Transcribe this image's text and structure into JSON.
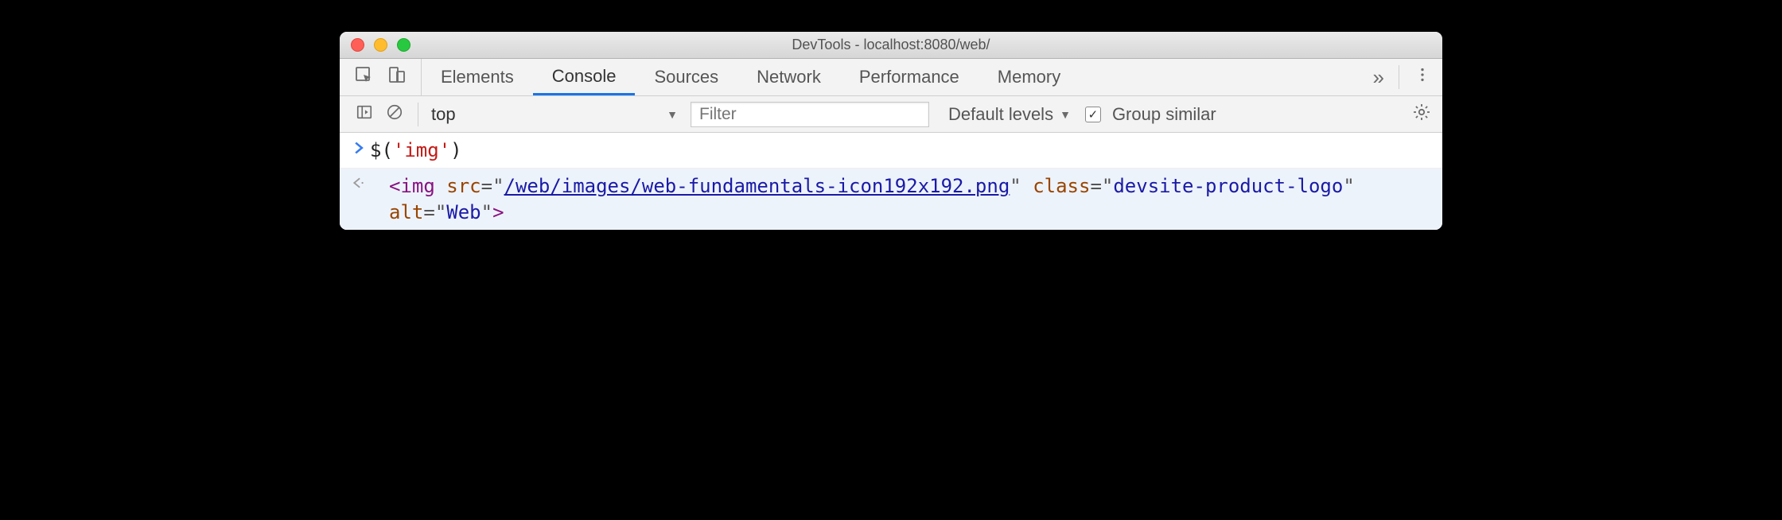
{
  "window": {
    "title": "DevTools - localhost:8080/web/"
  },
  "tabs": {
    "items": [
      "Elements",
      "Console",
      "Sources",
      "Network",
      "Performance",
      "Memory"
    ],
    "active_index": 1
  },
  "toolbar": {
    "context": "top",
    "filter_placeholder": "Filter",
    "levels_label": "Default levels",
    "group_similar_label": "Group similar",
    "group_similar_checked": true
  },
  "console": {
    "input": {
      "fn": "$",
      "open": "(",
      "arg": "'img'",
      "close": ")"
    },
    "output": {
      "tag_open": "<img",
      "attr_src": "src",
      "val_src": "/web/images/web-fundamentals-icon192x192.png",
      "attr_class": "class",
      "val_class": "devsite-product-logo",
      "attr_alt": "alt",
      "val_alt": "Web",
      "tag_close": ">",
      "eq": "=",
      "q": "\""
    }
  }
}
